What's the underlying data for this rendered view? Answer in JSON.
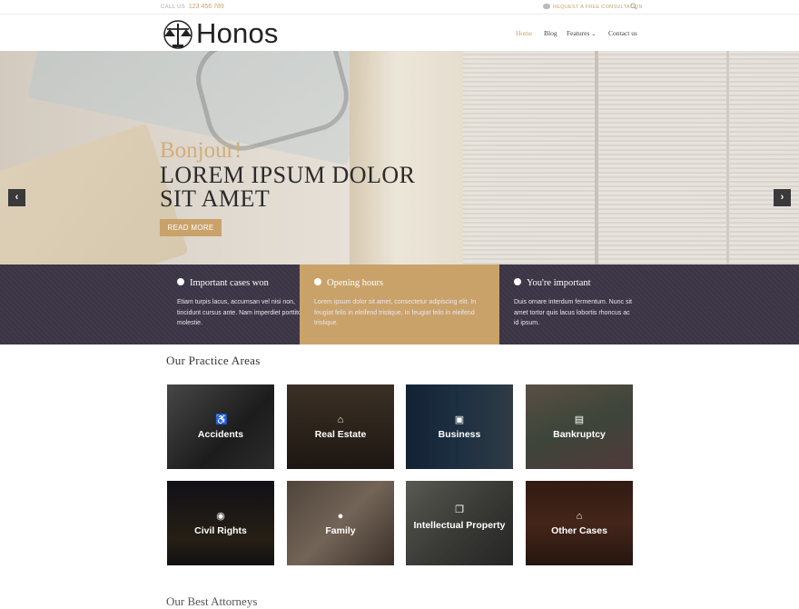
{
  "topbar": {
    "call_label": "CALL US",
    "phone": "123 456 789",
    "consult_label": "REQUEST A FREE CONSULTATION"
  },
  "header": {
    "logo_text": "Honos",
    "nav": [
      {
        "label": "Home",
        "active": true
      },
      {
        "label": "Blog"
      },
      {
        "label": "Features"
      },
      {
        "label": "Contact us"
      }
    ]
  },
  "hero": {
    "greeting": "Bonjour!",
    "headline": "LOREM IPSUM DOLOR SIT AMET",
    "button": "READ MORE",
    "prev_icon": "chevron-left-icon",
    "next_icon": "chevron-right-icon"
  },
  "band": [
    {
      "title": "Important cases won",
      "icon": "globe-icon",
      "text": "Etiam turpis lacus, accumsan vel nisi non, tincidunt cursus ante. Nam imperdiet porttitor molestie."
    },
    {
      "title": "Opening hours",
      "icon": "clock-icon",
      "text": "Lorem ipsum dolor sit amet, consectetur adipiscing elit. In feugiat felis in eleifend tristique. In feugiat felis in eleifend tristique."
    },
    {
      "title": "You're important",
      "icon": "user-icon",
      "text": "Duis ornare interdum fermentum. Nunc sit amet tortor quis lacus lobortis rhoncus ac id ipsum."
    }
  ],
  "practice": {
    "title": "Our Practice Areas",
    "areas": [
      {
        "label": "Accidents",
        "icon": "wheelchair-icon"
      },
      {
        "label": "Real Estate",
        "icon": "home-icon"
      },
      {
        "label": "Business",
        "icon": "money-icon"
      },
      {
        "label": "Bankruptcy",
        "icon": "credit-card-icon"
      },
      {
        "label": "Civil Rights",
        "icon": "globe-icon"
      },
      {
        "label": "Family",
        "icon": "users-icon"
      },
      {
        "label": "Intellectual Property",
        "icon": "copy-icon"
      },
      {
        "label": "Other Cases",
        "icon": "bank-icon"
      }
    ]
  },
  "next_section_title": "Our Best Attorneys",
  "colors": {
    "accent": "#c9a26a",
    "dark": "#3a3444"
  }
}
